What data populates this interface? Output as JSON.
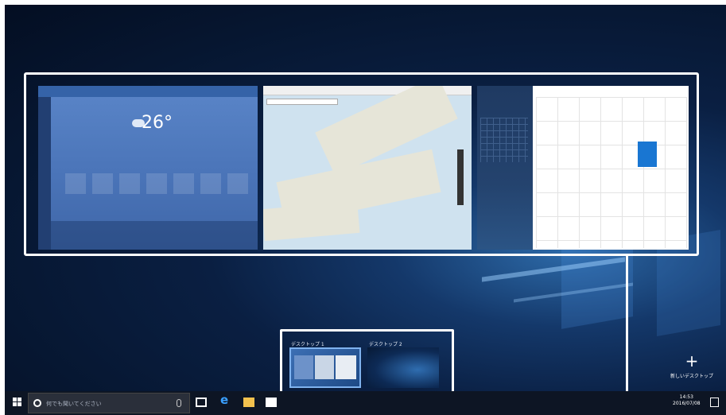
{
  "weather": {
    "temperature": "26°"
  },
  "desktops": {
    "desktop1_label": "デスクトップ 1",
    "desktop2_label": "デスクトップ 2",
    "new_desktop_label": "新しいデスクトップ",
    "new_desktop_icon": "plus-icon"
  },
  "taskbar": {
    "search_placeholder": "何でも聞いてください",
    "clock_time": "14:53",
    "clock_date": "2016/07/08"
  },
  "colors": {
    "frame": "#ffffff",
    "taskbar": "#0d1524",
    "calendar_accent": "#1976d2"
  }
}
